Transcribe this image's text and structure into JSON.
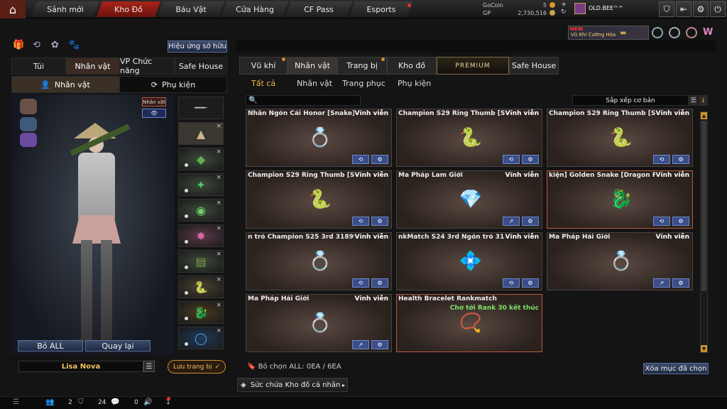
{
  "nav": {
    "tabs": [
      "Sảnh mới",
      "Kho Đồ",
      "Báu Vật",
      "Cửa Hàng",
      "CF Pass",
      "Esports"
    ],
    "active": 1
  },
  "currency": {
    "gocoin_label": "GoCoin",
    "gocoin_value": "5",
    "gp_label": "GP",
    "gp_value": "2,730,516"
  },
  "user": {
    "name": "OLD.BEE^^"
  },
  "promo": {
    "new_badge": "NEW",
    "text": "Vũ Khí Cường Hóa"
  },
  "left": {
    "effect_button": "Hiệu ứng sở hữu",
    "tabs": [
      "Túi",
      "Nhân vật",
      "VP Chức năng",
      "Safe House"
    ],
    "active_tab": 1,
    "subtabs": [
      "Nhân vật",
      "Phụ kiện"
    ],
    "character_badge": "Nhân vật",
    "buttons": {
      "remove_all": "Bỏ ALL",
      "back": "Quay lại"
    },
    "character_name": "Lisa Nova",
    "save_button": "Lưu trang bị"
  },
  "right": {
    "tabs": [
      "Vũ khí",
      "Nhân vật",
      "Trang bị",
      "Kho đồ",
      "PREMIUM",
      "Safe House"
    ],
    "active_tab": 1,
    "subtabs": [
      "Tất cả",
      "Nhân vật",
      "Trang phục",
      "Phụ kiện"
    ],
    "active_subtab": 0,
    "search_placeholder": "",
    "sort_label": "Sắp xếp cơ bản",
    "items": [
      {
        "name": "Nhẫn Ngón Cái Honor [Snake]",
        "duration": "Vĩnh viễn",
        "icon": "💍"
      },
      {
        "name": "Champion S29 Ring Thumb [Snake]",
        "duration": "Vĩnh viễn",
        "icon": "🐍"
      },
      {
        "name": "Champion S29 Ring Thumb [Snake]",
        "duration": "Vĩnh viễn",
        "icon": "🐍"
      },
      {
        "name": "Champion S29 Ring Thumb [Snake]",
        "duration": "Vĩnh viễn",
        "icon": "🐍"
      },
      {
        "name": "Ma Pháp Lam Giới",
        "duration": "Vĩnh viễn",
        "icon": "💎"
      },
      {
        "name": "kiện] Golden Snake [Dragon Fury]",
        "duration": "Vĩnh viễn",
        "icon": "🐉"
      },
      {
        "name": "n trỏ Champion S25 3rd 31899",
        "duration": "Vĩnh viễn",
        "icon": "💍"
      },
      {
        "name": "nkMatch S24 3rd Ngón trỏ 31899",
        "duration": "Vĩnh viễn",
        "icon": "💠"
      },
      {
        "name": "Ma Pháp Hải Giới",
        "duration": "Vĩnh viễn",
        "icon": "💍"
      },
      {
        "name": "Ma Pháp Hải Giới",
        "duration": "Vĩnh viễn",
        "icon": "💍"
      },
      {
        "name": "Health Bracelet Rankmatch",
        "duration": "",
        "rank": "Chơ tới Rank 30 kết thúc",
        "icon": "📿"
      }
    ],
    "footer_selected": "Bỏ chọn ALL: 0EA / 6EA",
    "clear_button": "Xóa mục đã chọn",
    "capacity_label": "Sức chứa Kho đồ cá nhân"
  },
  "statusbar": {
    "count1": "2",
    "count2": "24",
    "count3": "0",
    "count4": "1"
  }
}
